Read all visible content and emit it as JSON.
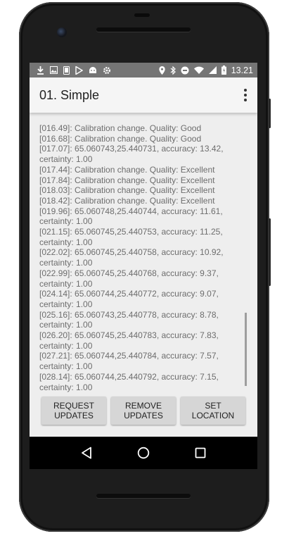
{
  "status_bar": {
    "time": "13.21",
    "left_icons": [
      "download-icon",
      "image-icon",
      "phone-icon",
      "play-store-icon",
      "android-icon",
      "settings-icon"
    ],
    "right_icons": [
      "location-icon",
      "bluetooth-icon",
      "do-not-disturb-icon",
      "wifi-icon",
      "signal-icon",
      "battery-icon"
    ]
  },
  "app_bar": {
    "title": "01. Simple"
  },
  "log": [
    "[016.49]: Calibration change. Quality: Good",
    "[016.68]: Calibration change. Quality: Good",
    "[017.07]: 65.060743,25.440731, accuracy: 13.42, certainty: 1.00",
    "[017.44]: Calibration change. Quality: Excellent",
    "[017.84]: Calibration change. Quality: Excellent",
    "[018.03]: Calibration change. Quality: Excellent",
    "[018.42]: Calibration change. Quality: Excellent",
    "[019.96]: 65.060748,25.440744, accuracy: 11.61, certainty: 1.00",
    "[021.15]: 65.060745,25.440753, accuracy: 11.25, certainty: 1.00",
    "[022.02]: 65.060745,25.440758, accuracy: 10.92, certainty: 1.00",
    "[022.99]: 65.060745,25.440768, accuracy: 9.37, certainty: 1.00",
    "[024.14]: 65.060744,25.440772, accuracy: 9.07, certainty: 1.00",
    "[025.16]: 65.060743,25.440778, accuracy: 8.78, certainty: 1.00",
    "[026.20]: 65.060745,25.440783, accuracy: 7.83, certainty: 1.00",
    "[027.21]: 65.060744,25.440784, accuracy: 7.57, certainty: 1.00",
    "[028.14]: 65.060744,25.440792, accuracy: 7.15, certainty: 1.00"
  ],
  "buttons": {
    "request_updates": "REQUEST UPDATES",
    "remove_updates": "REMOVE UPDATES",
    "set_location": "SET LOCATION"
  },
  "nav_bar": {
    "icons": [
      "back-icon",
      "home-icon",
      "recents-icon"
    ]
  },
  "colors": {
    "status_bar": "#757575",
    "app_bar": "#f5f5f5",
    "background": "#eeeeee",
    "button": "#d6d6d6",
    "log_text": "#6d6d6d"
  }
}
